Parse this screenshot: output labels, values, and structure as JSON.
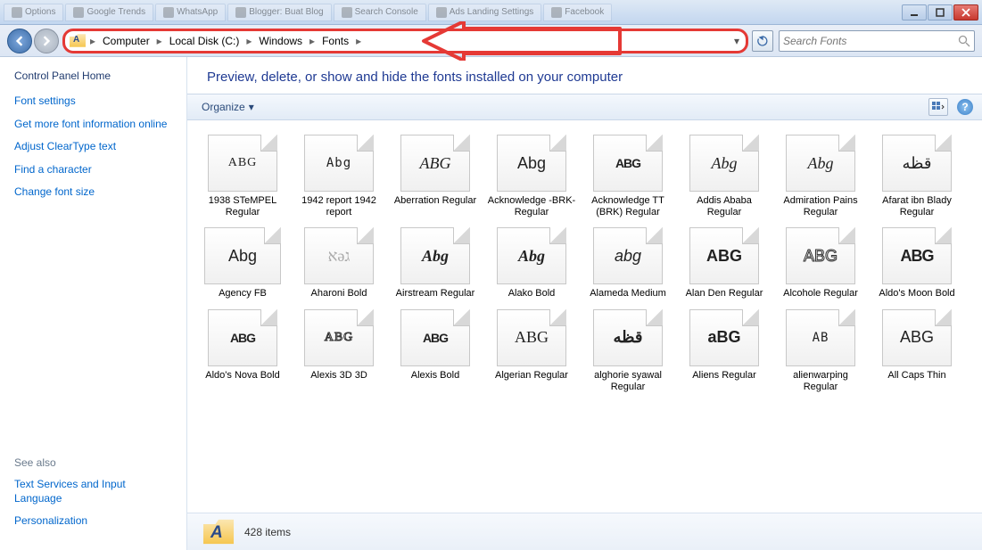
{
  "window": {
    "tabs": [
      "Options",
      "Google Trends",
      "WhatsApp",
      "Blogger: Buat Blog",
      "Search Console",
      "Ads Landing Settings",
      "Facebook"
    ]
  },
  "breadcrumb": [
    "Computer",
    "Local Disk (C:)",
    "Windows",
    "Fonts"
  ],
  "search": {
    "placeholder": "Search Fonts"
  },
  "sidebar": {
    "header": "Control Panel Home",
    "links": [
      "Font settings",
      "Get more font information online",
      "Adjust ClearType text",
      "Find a character",
      "Change font size"
    ],
    "seealso_header": "See also",
    "seealso": [
      "Text Services and Input Language",
      "Personalization"
    ]
  },
  "main": {
    "heading": "Preview, delete, or show and hide the fonts installed on your computer",
    "organize_label": "Organize"
  },
  "fonts": [
    {
      "label": "1938 STeMPEL Regular",
      "sample": "ABG",
      "cls": "s-small"
    },
    {
      "label": "1942 report 1942 report",
      "sample": "Abg",
      "cls": "s-mono s-small"
    },
    {
      "label": "Aberration Regular",
      "sample": "ABG",
      "cls": "s-italic"
    },
    {
      "label": "Acknowledge -BRK- Regular",
      "sample": "Abg",
      "cls": "s-sans"
    },
    {
      "label": "Acknowledge TT (BRK) Regular",
      "sample": "ABG",
      "cls": "s-block s-small"
    },
    {
      "label": "Addis Ababa Regular",
      "sample": "Abg",
      "cls": "s-script"
    },
    {
      "label": "Admiration Pains Regular",
      "sample": "Abg",
      "cls": "s-script"
    },
    {
      "label": "Afarat ibn Blady Regular",
      "sample": "قظه",
      "cls": ""
    },
    {
      "label": "Agency FB",
      "sample": "Abg",
      "cls": "s-sans",
      "collection": true
    },
    {
      "label": "Aharoni Bold",
      "sample": "אәג",
      "cls": "s-light"
    },
    {
      "label": "Airstream Regular",
      "sample": "Abg",
      "cls": "s-script s-bold"
    },
    {
      "label": "Alako Bold",
      "sample": "Abg",
      "cls": "s-italic s-bold"
    },
    {
      "label": "Alameda Medium",
      "sample": "abg",
      "cls": "s-script s-thin"
    },
    {
      "label": "Alan Den Regular",
      "sample": "ABG",
      "cls": "s-sans s-bold"
    },
    {
      "label": "Alcohole Regular",
      "sample": "ABG",
      "cls": "s-thin s-outline"
    },
    {
      "label": "Aldo's Moon Bold",
      "sample": "ABG",
      "cls": "s-block"
    },
    {
      "label": "Aldo's Nova Bold",
      "sample": "ABG",
      "cls": "s-block s-small"
    },
    {
      "label": "Alexis 3D 3D",
      "sample": "ABG",
      "cls": "s-outline s-small"
    },
    {
      "label": "Alexis Bold",
      "sample": "ABG",
      "cls": "s-block s-small"
    },
    {
      "label": "Algerian Regular",
      "sample": "ABG",
      "cls": ""
    },
    {
      "label": "alghorie syawal Regular",
      "sample": "قظه",
      "cls": "s-bold"
    },
    {
      "label": "Aliens Regular",
      "sample": "aBG",
      "cls": "s-sans s-bold"
    },
    {
      "label": "alienwarping Regular",
      "sample": "AB",
      "cls": "s-mono s-small"
    },
    {
      "label": "All Caps Thin",
      "sample": "ABG",
      "cls": "s-thin"
    }
  ],
  "status": {
    "count_text": "428 items"
  }
}
